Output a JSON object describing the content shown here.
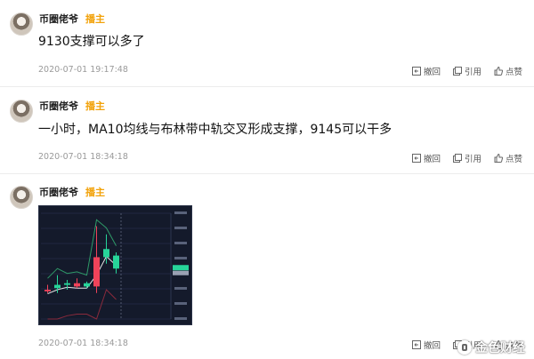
{
  "posts": [
    {
      "author": "币圈佬爷",
      "role": "播主",
      "content": "9130支撑可以多了",
      "time": "2020-07-01 19:17:48",
      "actions": [
        "撤回",
        "引用",
        "点赞"
      ]
    },
    {
      "author": "币圈佬爷",
      "role": "播主",
      "content": "一小时，MA10均线与布林带中轨交叉形成支撑，9145可以干多",
      "time": "2020-07-01 18:34:18",
      "actions": [
        "撤回",
        "引用",
        "点赞"
      ]
    },
    {
      "author": "币圈佬爷",
      "role": "播主",
      "time": "2020-07-01 18:34:18",
      "actions": [
        "撤回",
        "引用",
        "点赞"
      ]
    }
  ],
  "colors": {
    "role": "#f2a20a",
    "up": "#27d59a",
    "down": "#f0435a",
    "chart_bg": "#141a2b"
  },
  "watermark": "金色财经",
  "chart_data": {
    "type": "candlestick",
    "candles": [
      {
        "o": 9128,
        "h": 9131,
        "l": 9126,
        "c": 9127,
        "dir": "down"
      },
      {
        "o": 9129,
        "h": 9137,
        "l": 9126,
        "c": 9131,
        "dir": "up"
      },
      {
        "o": 9131,
        "h": 9134,
        "l": 9128,
        "c": 9132,
        "dir": "up"
      },
      {
        "o": 9132,
        "h": 9135,
        "l": 9129,
        "c": 9130,
        "dir": "down"
      },
      {
        "o": 9130,
        "h": 9133,
        "l": 9129,
        "c": 9132,
        "dir": "up"
      },
      {
        "o": 9148,
        "h": 9167,
        "l": 9126,
        "c": 9130,
        "dir": "down"
      },
      {
        "o": 9148,
        "h": 9162,
        "l": 9144,
        "c": 9153,
        "dir": "up"
      },
      {
        "o": 9141,
        "h": 9151,
        "l": 9138,
        "c": 9149,
        "dir": "up"
      }
    ],
    "ylim": [
      9110,
      9175
    ]
  }
}
